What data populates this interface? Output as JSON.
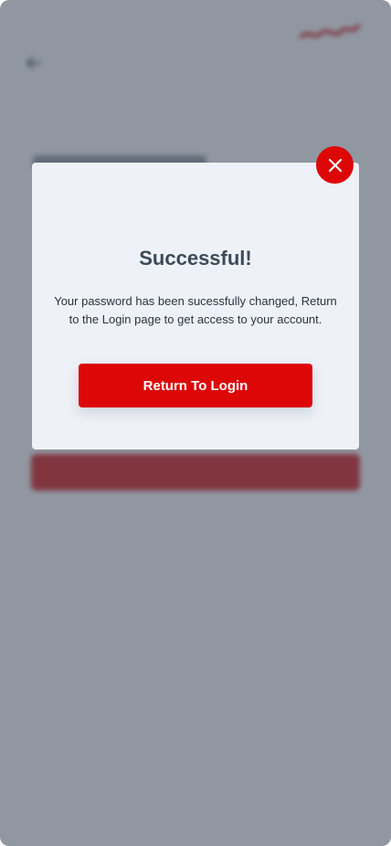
{
  "modal": {
    "title": "Successful!",
    "message": "Your password has been sucessfully changed, Return to the Login page to get access to your account.",
    "button_label": "Return To Login",
    "close_icon": "close-icon"
  },
  "colors": {
    "accent": "#dd0707",
    "overlay": "#8c96a2",
    "modal_bg": "#eef2f8",
    "title_text": "#3d4a58"
  }
}
